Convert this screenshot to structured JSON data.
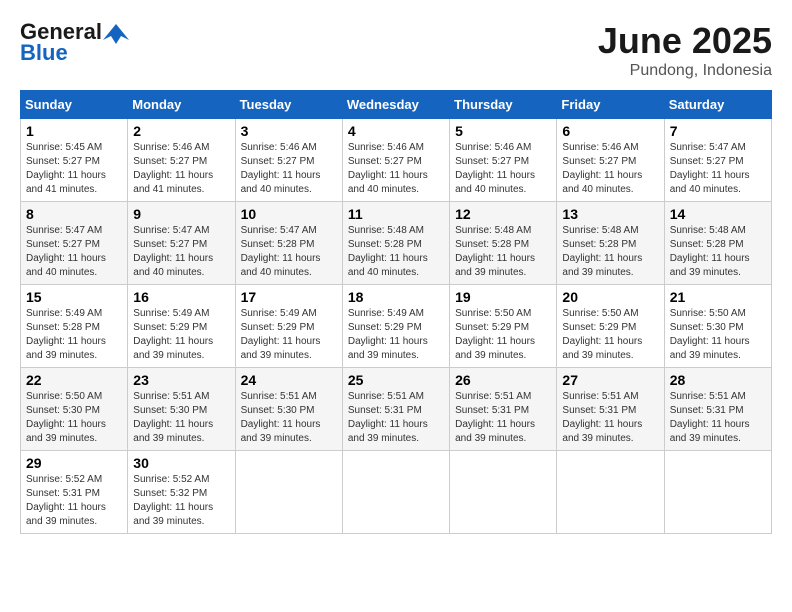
{
  "logo": {
    "line1": "General",
    "line2": "Blue"
  },
  "title": "June 2025",
  "location": "Pundong, Indonesia",
  "days_of_week": [
    "Sunday",
    "Monday",
    "Tuesday",
    "Wednesday",
    "Thursday",
    "Friday",
    "Saturday"
  ],
  "weeks": [
    [
      {
        "day": "1",
        "sunrise": "5:45 AM",
        "sunset": "5:27 PM",
        "daylight": "11 hours and 41 minutes."
      },
      {
        "day": "2",
        "sunrise": "5:46 AM",
        "sunset": "5:27 PM",
        "daylight": "11 hours and 41 minutes."
      },
      {
        "day": "3",
        "sunrise": "5:46 AM",
        "sunset": "5:27 PM",
        "daylight": "11 hours and 40 minutes."
      },
      {
        "day": "4",
        "sunrise": "5:46 AM",
        "sunset": "5:27 PM",
        "daylight": "11 hours and 40 minutes."
      },
      {
        "day": "5",
        "sunrise": "5:46 AM",
        "sunset": "5:27 PM",
        "daylight": "11 hours and 40 minutes."
      },
      {
        "day": "6",
        "sunrise": "5:46 AM",
        "sunset": "5:27 PM",
        "daylight": "11 hours and 40 minutes."
      },
      {
        "day": "7",
        "sunrise": "5:47 AM",
        "sunset": "5:27 PM",
        "daylight": "11 hours and 40 minutes."
      }
    ],
    [
      {
        "day": "8",
        "sunrise": "5:47 AM",
        "sunset": "5:27 PM",
        "daylight": "11 hours and 40 minutes."
      },
      {
        "day": "9",
        "sunrise": "5:47 AM",
        "sunset": "5:27 PM",
        "daylight": "11 hours and 40 minutes."
      },
      {
        "day": "10",
        "sunrise": "5:47 AM",
        "sunset": "5:28 PM",
        "daylight": "11 hours and 40 minutes."
      },
      {
        "day": "11",
        "sunrise": "5:48 AM",
        "sunset": "5:28 PM",
        "daylight": "11 hours and 40 minutes."
      },
      {
        "day": "12",
        "sunrise": "5:48 AM",
        "sunset": "5:28 PM",
        "daylight": "11 hours and 39 minutes."
      },
      {
        "day": "13",
        "sunrise": "5:48 AM",
        "sunset": "5:28 PM",
        "daylight": "11 hours and 39 minutes."
      },
      {
        "day": "14",
        "sunrise": "5:48 AM",
        "sunset": "5:28 PM",
        "daylight": "11 hours and 39 minutes."
      }
    ],
    [
      {
        "day": "15",
        "sunrise": "5:49 AM",
        "sunset": "5:28 PM",
        "daylight": "11 hours and 39 minutes."
      },
      {
        "day": "16",
        "sunrise": "5:49 AM",
        "sunset": "5:29 PM",
        "daylight": "11 hours and 39 minutes."
      },
      {
        "day": "17",
        "sunrise": "5:49 AM",
        "sunset": "5:29 PM",
        "daylight": "11 hours and 39 minutes."
      },
      {
        "day": "18",
        "sunrise": "5:49 AM",
        "sunset": "5:29 PM",
        "daylight": "11 hours and 39 minutes."
      },
      {
        "day": "19",
        "sunrise": "5:50 AM",
        "sunset": "5:29 PM",
        "daylight": "11 hours and 39 minutes."
      },
      {
        "day": "20",
        "sunrise": "5:50 AM",
        "sunset": "5:29 PM",
        "daylight": "11 hours and 39 minutes."
      },
      {
        "day": "21",
        "sunrise": "5:50 AM",
        "sunset": "5:30 PM",
        "daylight": "11 hours and 39 minutes."
      }
    ],
    [
      {
        "day": "22",
        "sunrise": "5:50 AM",
        "sunset": "5:30 PM",
        "daylight": "11 hours and 39 minutes."
      },
      {
        "day": "23",
        "sunrise": "5:51 AM",
        "sunset": "5:30 PM",
        "daylight": "11 hours and 39 minutes."
      },
      {
        "day": "24",
        "sunrise": "5:51 AM",
        "sunset": "5:30 PM",
        "daylight": "11 hours and 39 minutes."
      },
      {
        "day": "25",
        "sunrise": "5:51 AM",
        "sunset": "5:31 PM",
        "daylight": "11 hours and 39 minutes."
      },
      {
        "day": "26",
        "sunrise": "5:51 AM",
        "sunset": "5:31 PM",
        "daylight": "11 hours and 39 minutes."
      },
      {
        "day": "27",
        "sunrise": "5:51 AM",
        "sunset": "5:31 PM",
        "daylight": "11 hours and 39 minutes."
      },
      {
        "day": "28",
        "sunrise": "5:51 AM",
        "sunset": "5:31 PM",
        "daylight": "11 hours and 39 minutes."
      }
    ],
    [
      {
        "day": "29",
        "sunrise": "5:52 AM",
        "sunset": "5:31 PM",
        "daylight": "11 hours and 39 minutes."
      },
      {
        "day": "30",
        "sunrise": "5:52 AM",
        "sunset": "5:32 PM",
        "daylight": "11 hours and 39 minutes."
      },
      null,
      null,
      null,
      null,
      null
    ]
  ]
}
